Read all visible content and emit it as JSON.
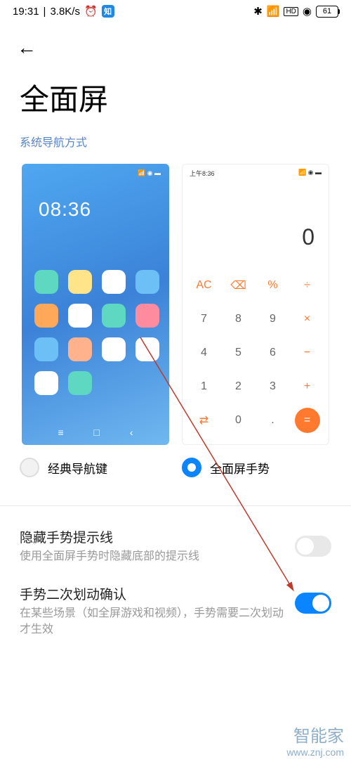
{
  "status": {
    "time": "19:31",
    "speed": "3.8K/s",
    "battery": "61"
  },
  "page": {
    "title": "全面屏",
    "section_label": "系统导航方式"
  },
  "preview_home": {
    "clock": "08:36",
    "icon_colors": [
      "#5ed8c0",
      "#ffe48a",
      "#ffffff",
      "#6dc0f5",
      "#ffa85a",
      "#ffffff",
      "#5ed8c0",
      "#ff8b9e",
      "#6dc0f5",
      "#ffb28b",
      "#ffffff",
      "#ffffff",
      "#ffffff",
      "#5ed8c0"
    ]
  },
  "preview_calc": {
    "status_time": "上午8:36",
    "display": "0",
    "rows": [
      [
        "AC",
        "⌫",
        "%",
        "÷"
      ],
      [
        "7",
        "8",
        "9",
        "×"
      ],
      [
        "4",
        "5",
        "6",
        "−"
      ],
      [
        "1",
        "2",
        "3",
        "+"
      ],
      [
        "⇄",
        "0",
        ".",
        "="
      ]
    ],
    "ops": [
      "AC",
      "⌫",
      "%",
      "÷",
      "×",
      "−",
      "+",
      "⇄",
      "="
    ]
  },
  "options": {
    "classic": "经典导航键",
    "gesture": "全面屏手势"
  },
  "settings": {
    "hide_line": {
      "title": "隐藏手势提示线",
      "desc": "使用全面屏手势时隐藏底部的提示线",
      "on": false
    },
    "double_swipe": {
      "title": "手势二次划动确认",
      "desc": "在某些场景（如全屏游戏和视频），手势需要二次划动才生效",
      "on": true
    }
  },
  "watermark": {
    "cn": "智能家",
    "url": "www.znj.com"
  }
}
